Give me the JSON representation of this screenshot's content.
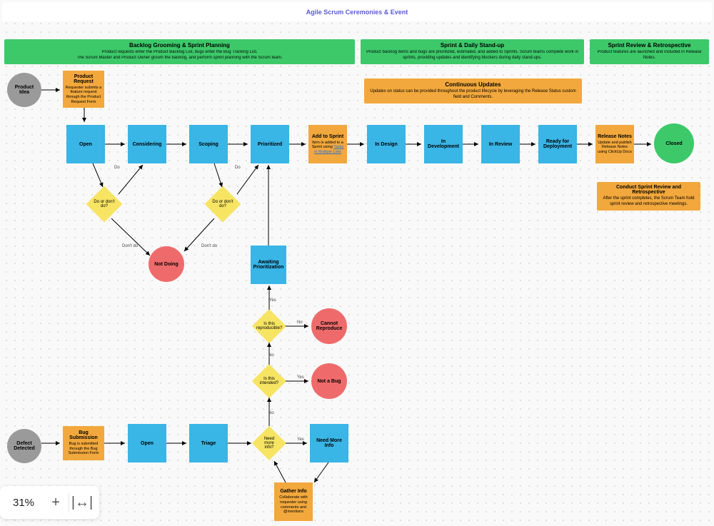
{
  "title": "Agile Scrum Ceremonies & Event",
  "banners": {
    "b1": {
      "t": "Backlog Grooming & Sprint Planning",
      "d1": "Product requests enter the Product Backlog List, bugs enter the Bug Tracking List.",
      "d2": "The Scrum Master and Product Owner groom the backlog, and perform sprint planning with the Scrum team."
    },
    "b2": {
      "t": "Sprint & Daily Stand-up",
      "d": "Product backlog items and bugs are prioritized, estimated, and added to Sprints. Scrum teams complete work in sprints, providing updates and identifying blockers during daily stand-ups."
    },
    "b3": {
      "t": "Sprint Review & Retrospective",
      "d": "Product features are launched and included in Release Notes."
    },
    "cu": {
      "t": "Continuous Updates",
      "d": "Updates on status can be provided throughout the product lifecycle by leveraging the Release Status custom field and Comments."
    },
    "srr": {
      "t": "Conduct Sprint Review and Retrospective",
      "d": "After the sprint completes, the Scrum Team hold sprint review and retrospective meetings."
    }
  },
  "nodes": {
    "product_idea": "Product Idea",
    "product_request": {
      "t": "Product Request",
      "d": "Requester submits a feature request through the Product Request Form"
    },
    "open1": "Open",
    "considering": "Considering",
    "scoping": "Scoping",
    "prioritized": "Prioritized",
    "add_sprint": {
      "t": "Add to Sprint",
      "d1": "Item is added to a Sprint using ",
      "link": "Tasks in Multiple Lists"
    },
    "in_design": "In Design",
    "in_dev": "In Development",
    "in_review": "In Review",
    "ready_deploy": "Ready for Deployment",
    "release_notes": {
      "t": "Release Notes",
      "d": "Update and publish Release Notes using ClickUp Docs"
    },
    "closed": "Closed",
    "dec1": "Do or don't do?",
    "dec2": "Do or don't do?",
    "not_doing": "Not Doing",
    "await_pri": "Awaiting Prioritization",
    "dec_repro": "Is this reproducible?",
    "cannot_repro": "Cannot Reproduce",
    "dec_intended": "Is this intended?",
    "not_bug": "Not a Bug",
    "dec_more": "Need more info?",
    "need_more": "Need More Info",
    "gather": {
      "t": "Gather Info",
      "d": "Collaborate with requester using comments and @mentions"
    },
    "defect": "Defect Detected",
    "bug_sub": {
      "t": "Bug Submission",
      "d": "Bug is submitted through the Bug Submission Form"
    },
    "open2": "Open",
    "triage": "Triage"
  },
  "edge_labels": {
    "do": "Do",
    "dont_do": "Don't do",
    "no": "No",
    "yes": "Yes"
  },
  "zoom": {
    "pct": "31%",
    "plus": "+",
    "fit": "|↔|"
  }
}
